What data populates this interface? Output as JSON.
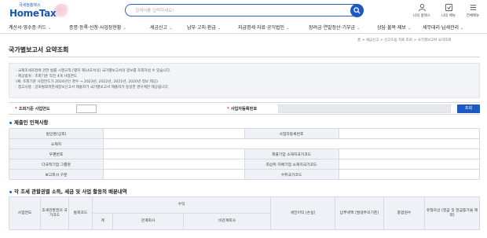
{
  "header": {
    "logo_sub": "국세청홈택스",
    "logo_main": "HomeTax",
    "search_placeholder": "검색어를 입력하세요!",
    "icons": [
      {
        "name": "mypage-icon",
        "label": "나의 홈택스"
      },
      {
        "name": "mymenu-icon",
        "label": "나의 메뉴"
      },
      {
        "name": "allmenu-icon",
        "label": "전체메뉴"
      }
    ]
  },
  "nav": {
    "items": [
      "계산서·영수증·카드",
      "증명·등록·신청·사업장현황",
      "세금신고",
      "납부·고지·환급",
      "지급명세·자료·공익법인",
      "장려금·연말정산·기부금",
      "상담·불복·제보",
      "세무대리·납세관리"
    ],
    "chevron": "⌄"
  },
  "breadcrumb": "홈 > 세금신고 > 신고도움 자료 조회 > 국가별보고서 요약조회",
  "page_title": "국가별보고서 요약조회",
  "info": {
    "lines": [
      "· 국제조세조정에 관한 법률 시행규칙 [별지 제14호서식] 국가별보고서의 정보를 조회하실 수 있습니다.",
      "· 제공범위 : 조회기준 직전 4개 사업연도",
      "  (예: 조회기준 사업연도가 2024년인 경우 → 2023년, 2022년, 2021년, 2020년 정보 제공)",
      "· 참고사항 : 글로벌최저한세정보신고서 제출자가 국가별보고서 제출자가 동일한 경우에만 제공됩니다."
    ]
  },
  "query": {
    "year_label": "조회기준 사업연도",
    "year_value": "",
    "bizno_label": "사업자등록번호",
    "bizno_value": "",
    "required_mark": "*",
    "button": "조회"
  },
  "section1": {
    "title": "제출인 인적사항",
    "rows": [
      {
        "left": "법인명(상호)",
        "right": "사업자등록번호"
      },
      {
        "left": "소재지",
        "right": ""
      },
      {
        "left": "우편번호",
        "right": "제출기업 소재지국가코드"
      },
      {
        "left": "다국적기업 그룹명",
        "right": "최상위 지배기업 소재지국가코드"
      },
      {
        "left": "보고회사 구분",
        "right": "수취국가코드"
      }
    ]
  },
  "section2": {
    "title": "각 조세 관할권별 소득, 세금 및 사업 활동의 배분내역",
    "headers": {
      "year": "사업연도",
      "juris": "조세관할권의 국가코드",
      "currency": "통화코드",
      "revenue": "수익",
      "rev_total": "계",
      "rev_related": "관계회사",
      "rev_unrelated": "비관계회사",
      "pretax": "세전이익 (손실)",
      "taxpaid": "납부세액 (발생주의기준)",
      "employees": "종업원수",
      "tangible": "유형자산 (현금 및 현금등가물 제외)"
    }
  }
}
